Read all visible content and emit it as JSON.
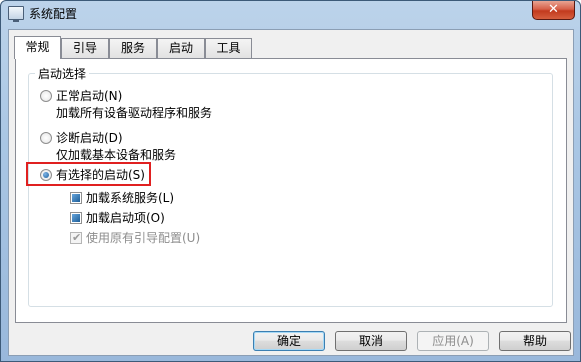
{
  "window": {
    "title": "系统配置",
    "close_glyph": "✕",
    "app_icon": "monitor-icon"
  },
  "tabs": [
    {
      "label": "常规",
      "active": true
    },
    {
      "label": "引导",
      "active": false
    },
    {
      "label": "服务",
      "active": false
    },
    {
      "label": "启动",
      "active": false
    },
    {
      "label": "工具",
      "active": false
    }
  ],
  "startup": {
    "group_title": "启动选择",
    "normal": {
      "label": "正常启动(N)",
      "desc": "加载所有设备驱动程序和服务",
      "checked": false
    },
    "diagnostic": {
      "label": "诊断启动(D)",
      "desc": "仅加载基本设备和服务",
      "checked": false
    },
    "selective": {
      "label": "有选择的启动(S)",
      "checked": true
    },
    "options": {
      "load_services": {
        "label": "加载系统服务(L)",
        "state": "indeterminate"
      },
      "load_startup": {
        "label": "加载启动项(O)",
        "state": "indeterminate"
      },
      "original_boot": {
        "label": "使用原有引导配置(U)",
        "state": "checked-disabled"
      }
    }
  },
  "buttons": {
    "ok": "确定",
    "cancel": "取消",
    "apply": "应用(A)",
    "help": "帮助"
  },
  "colors": {
    "highlight_border": "#e02020",
    "titlebar": "#a9c6e4",
    "close_button": "#c23a1e"
  }
}
